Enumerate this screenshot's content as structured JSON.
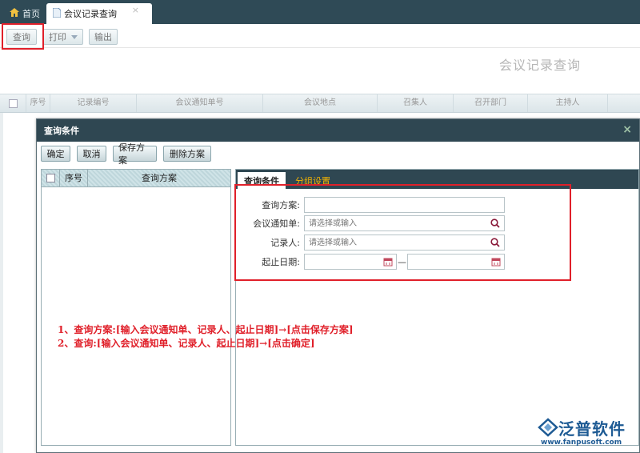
{
  "tabs": {
    "home_label": "首页",
    "active_label": "会议记录查询",
    "close_glyph": "×"
  },
  "toolbar": {
    "query_label": "查询",
    "print_label": "打印",
    "export_label": "输出"
  },
  "page_title": "会议记录查询",
  "grid": {
    "columns": [
      "序号",
      "记录编号",
      "会议通知单号",
      "会议地点",
      "召集人",
      "召开部门",
      "主持人"
    ]
  },
  "dialog": {
    "title": "查询条件",
    "close_glyph": "×",
    "buttons": {
      "confirm": "确定",
      "cancel": "取消",
      "save_scheme": "保存方案",
      "delete_scheme": "删除方案"
    },
    "left_pane": {
      "col_index": "序号",
      "col_scheme": "查询方案"
    },
    "tabs": {
      "conditions": "查询条件",
      "group_settings": "分组设置"
    },
    "form": {
      "scheme_label": "查询方案:",
      "scheme_value": "",
      "notice_label": "会议通知单:",
      "notice_placeholder": "请选择或输入",
      "recorder_label": "记录人:",
      "recorder_placeholder": "请选择或输入",
      "date_label": "起止日期:",
      "date_separator": "—",
      "date_from": "",
      "date_to": ""
    }
  },
  "instructions": {
    "line1": "1、查询方案:[输入会议通知单、记录人、起止日期]→[点击保存方案]",
    "line2": "2、查询:[输入会议通知单、记录人、起止日期]→[点击确定]"
  },
  "logo": {
    "name": "泛普软件",
    "url": "www.fanpusoft.com"
  },
  "colors": {
    "dark_header": "#2f4752",
    "highlight_red": "#e0202a",
    "tab_inactive": "#f5b400",
    "brand_blue": "#1e5b94"
  },
  "icons": {
    "home": "home-icon",
    "document": "document-icon",
    "search": "search-icon",
    "calendar": "calendar-icon",
    "close": "close-icon"
  }
}
